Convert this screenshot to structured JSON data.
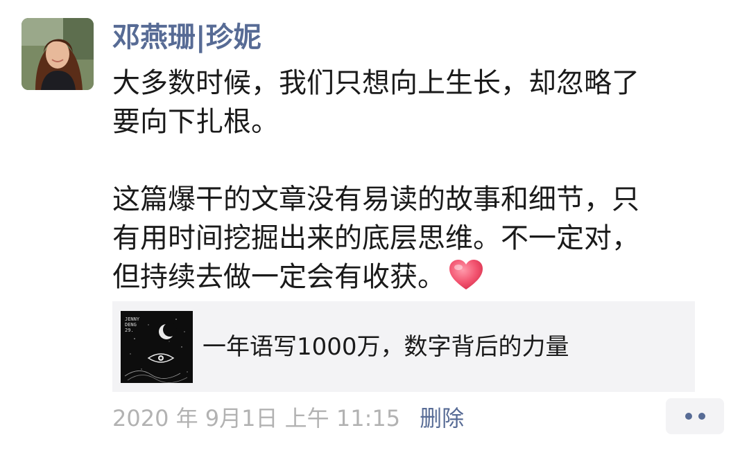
{
  "post": {
    "author": "邓燕珊|珍妮",
    "paragraph_1": "大多数时候，我们只想向上生长，却忽略了\n要向下扎根。",
    "paragraph_2": "这篇爆干的文章没有易读的故事和细节，只\n有用时间挖掘出来的底层思维。不一定对，\n但持续去做一定会有收获。",
    "emoji": "heart-icon"
  },
  "link_card": {
    "thumbnail_text": "JENNY\nDENG\n29.",
    "title": "一年语写1000万，数字背后的力量"
  },
  "meta": {
    "timestamp": "2020 年 9月1日 上午 11:15",
    "delete_label": "删除"
  },
  "colors": {
    "link_blue": "#576b95",
    "timestamp_gray": "#b2b2b2",
    "card_bg": "#f3f3f5",
    "heart_pink": "#f25a74"
  }
}
